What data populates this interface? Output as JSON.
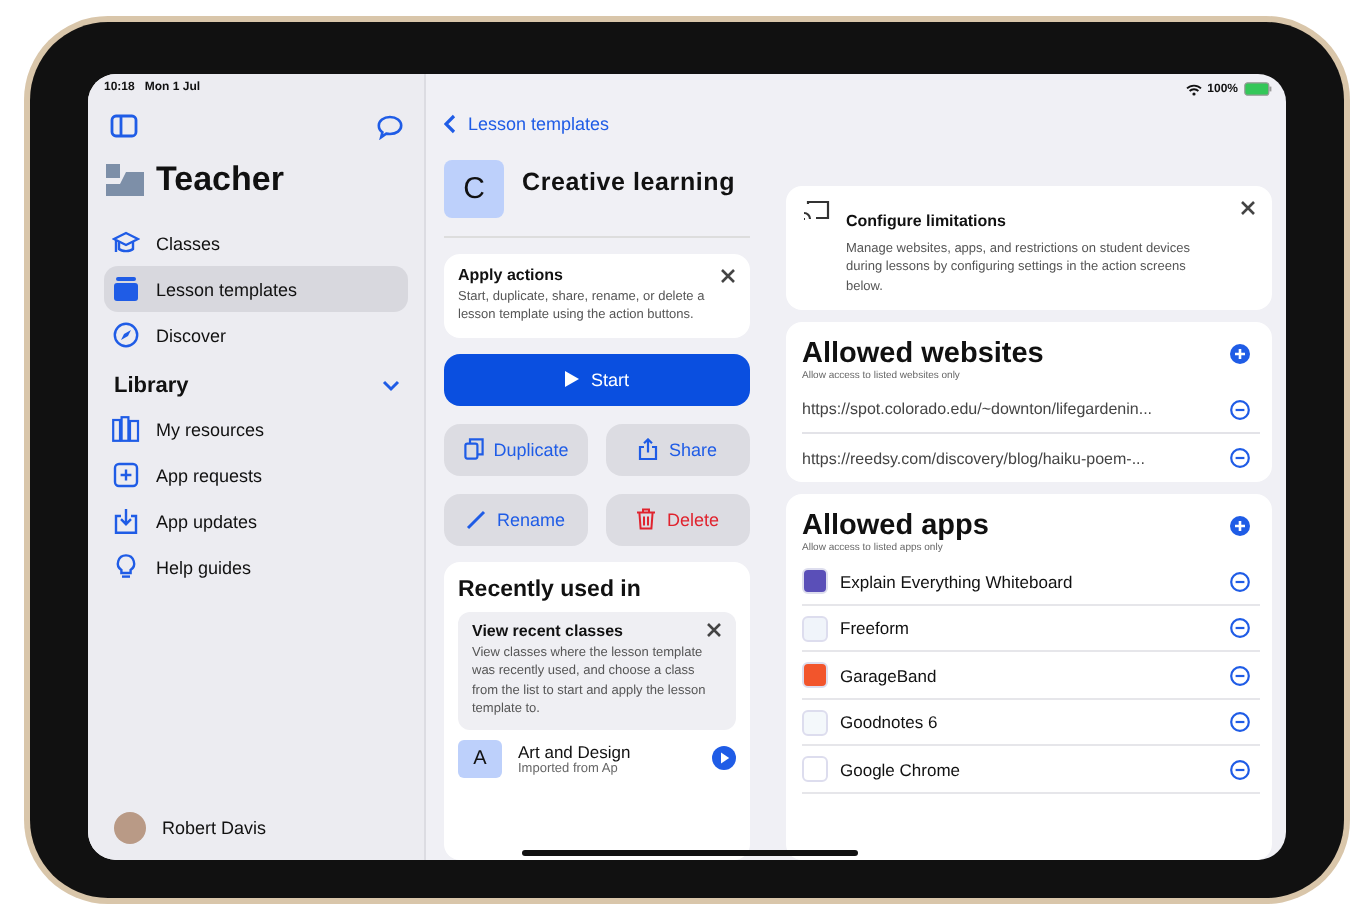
{
  "status_bar": {
    "time": "10:18",
    "date": "Mon 1 Jul",
    "battery": "100%"
  },
  "sidebar": {
    "title": "Teacher",
    "items": [
      {
        "label": "Classes",
        "selected": false
      },
      {
        "label": "Lesson templates",
        "selected": true
      },
      {
        "label": "Discover",
        "selected": false
      }
    ],
    "library": {
      "title": "Library",
      "expanded": true,
      "items": [
        "My resources",
        "App requests",
        "App updates",
        "Help guides"
      ]
    },
    "user": {
      "name": "Robert Davis"
    }
  },
  "template": {
    "back": "Lesson templates",
    "initial": "C",
    "title": "Creative learning",
    "tip": {
      "title": "Apply actions",
      "text": "Start, duplicate, share, rename, or delete a lesson template using the action buttons."
    },
    "actions": [
      {
        "label": "Start",
        "kind": "primary"
      },
      {
        "label": "Duplicate",
        "kind": "secondary"
      },
      {
        "label": "Share",
        "kind": "secondary"
      },
      {
        "label": "Rename",
        "kind": "secondary"
      },
      {
        "label": "Delete",
        "kind": "destructive"
      }
    ],
    "recent": {
      "title": "Recently used in",
      "tip": {
        "title": "View recent classes",
        "text": "View classes where the lesson template was recently used, and choose a class from the list to start and apply the lesson template to."
      },
      "classes": [
        {
          "initial": "A",
          "name": "Art and Design",
          "detail": "Imported from Ap"
        }
      ]
    }
  },
  "limitations": {
    "title": "Configure limitations",
    "text": "Manage websites, apps, and restrictions on student devices during lessons by configuring settings in the action screens below."
  },
  "websites": {
    "title": "Allowed websites",
    "subtitle": "Allow access to listed websites only",
    "items": [
      "https://spot.colorado.edu/~downton/lifegardenin...",
      "https://reedsy.com/discovery/blog/haiku-poem-..."
    ]
  },
  "apps": {
    "title": "Allowed apps",
    "subtitle": "Allow access to listed apps only",
    "items": [
      {
        "name": "Explain Everything Whiteboard",
        "color": "#5a4fb8"
      },
      {
        "name": "Freeform",
        "color": "#f0f4fa"
      },
      {
        "name": "GarageBand",
        "color": "#f2552c"
      },
      {
        "name": "Goodnotes 6",
        "color": "#f4f8fb"
      },
      {
        "name": "Google Chrome",
        "color": "#ffffff"
      }
    ]
  }
}
